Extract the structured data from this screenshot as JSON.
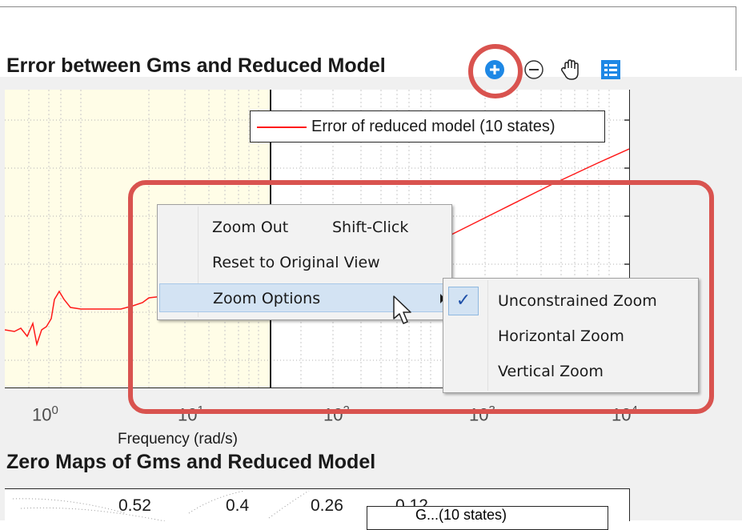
{
  "plot1": {
    "title": "Error between Gms and Reduced Model",
    "legend_entry": "Error of reduced model (10 states)",
    "xlabel": "Frequency (rad/s)",
    "xticks": [
      {
        "base": "10",
        "exp": "0"
      },
      {
        "base": "10",
        "exp": "1"
      },
      {
        "base": "10",
        "exp": "2"
      },
      {
        "base": "10",
        "exp": "3"
      },
      {
        "base": "10",
        "exp": "4"
      }
    ],
    "line_color": "#ff1a1a",
    "shade_color": "#fffde7"
  },
  "toolbar": {
    "icons": [
      "zoom-in-icon",
      "zoom-out-icon",
      "pan-hand-icon",
      "legend-icon"
    ],
    "accent": "#1e88e5"
  },
  "context_menu": {
    "zoom_out": {
      "label": "Zoom Out",
      "shortcut": "Shift-Click"
    },
    "reset": {
      "label": "Reset to Original View"
    },
    "zoom_options": {
      "label": "Zoom Options"
    }
  },
  "submenu": {
    "check_mark": "✓",
    "items": [
      {
        "label": "Unconstrained Zoom",
        "checked": true
      },
      {
        "label": "Horizontal Zoom",
        "checked": false
      },
      {
        "label": "Vertical Zoom",
        "checked": false
      }
    ]
  },
  "plot2": {
    "title": "Zero Maps of Gms and Reduced Model",
    "labels": [
      "0.52",
      "0.4",
      "0.26",
      "0.12"
    ],
    "legend_partial": "G...(10 states)"
  },
  "highlight_color": "#d9534f"
}
